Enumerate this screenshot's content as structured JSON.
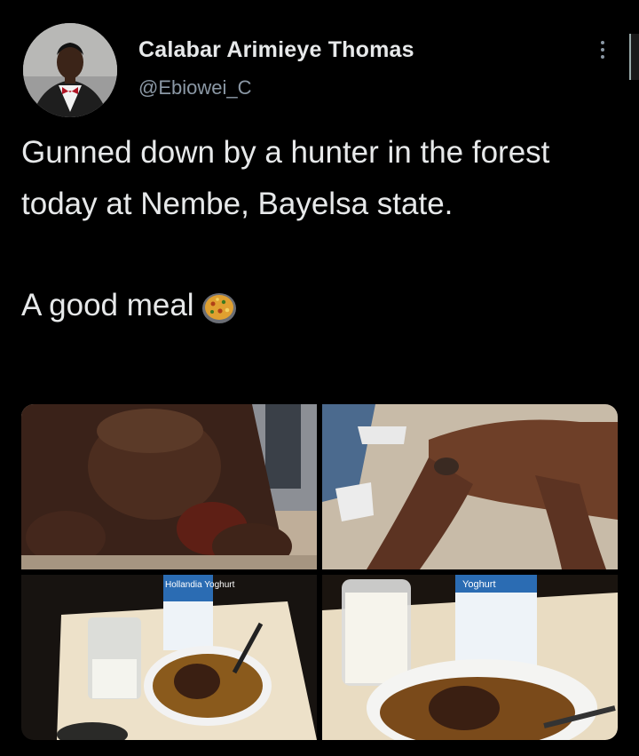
{
  "tweet": {
    "author_name": "Calabar Arimieye Thomas",
    "handle": "@Ebiowei_C",
    "text_line1": "Gunned down by a hunter in the forest today at Nembe, Bayelsa state.",
    "text_line2": "A good meal",
    "emoji": "paella-pan-emoji"
  },
  "media": {
    "photo_3_carton_text": "Hollandia Yoghurt",
    "photo_4_carton_text": "Yoghurt"
  },
  "colors": {
    "background": "#000000",
    "text_primary": "#e7e9ea",
    "text_secondary": "#8b98a5"
  }
}
